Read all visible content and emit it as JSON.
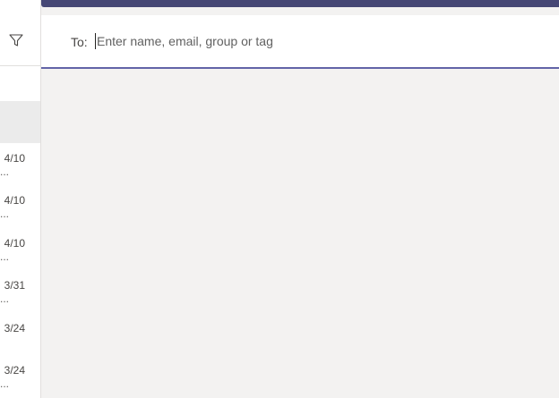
{
  "compose": {
    "to_label": "To:",
    "placeholder": "Enter name, email, group or tag"
  },
  "chat_list": {
    "items": [
      {
        "date": "4/10",
        "snippet": "..."
      },
      {
        "date": "4/10",
        "snippet": "..."
      },
      {
        "date": "4/10",
        "snippet": "..."
      },
      {
        "date": "3/31",
        "snippet": "e..."
      },
      {
        "date": "3/24",
        "snippet": ""
      },
      {
        "date": "3/24",
        "snippet": "..."
      }
    ]
  },
  "icons": {
    "filter": "filter-icon"
  },
  "colors": {
    "accent": "#6264a7",
    "topbar": "#464775",
    "canvas": "#f3f2f1"
  }
}
